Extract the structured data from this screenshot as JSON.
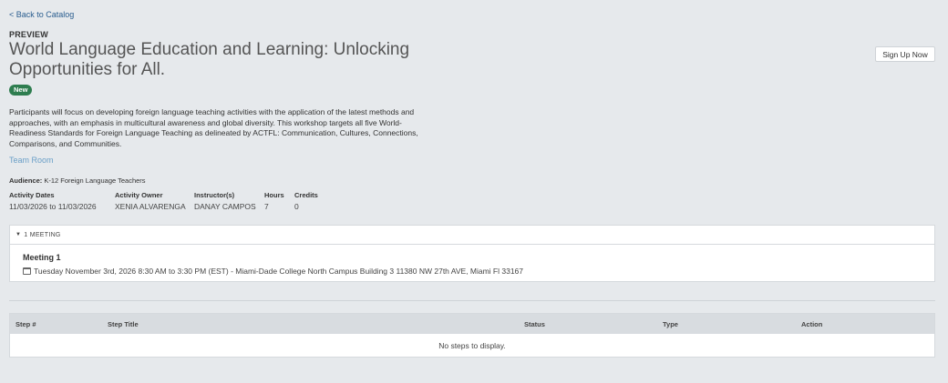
{
  "nav": {
    "back_label": "< Back to Catalog"
  },
  "course": {
    "preview_label": "PREVIEW",
    "title": "World Language Education and Learning: Unlocking Opportunities for All.",
    "badge": "New",
    "description": "Participants will focus on developing foreign language teaching activities with the application of the latest methods and approaches, with an emphasis in multicultural awareness and global diversity. This workshop targets all five World-Readiness Standards for Foreign Language Teaching as delineated by ACTFL: Communication, Cultures, Connections, Comparisons, and Communities.",
    "team_room_link": "Team Room",
    "audience_label": "Audience:",
    "audience_value": "K-12 Foreign Language Teachers",
    "signup_label": "Sign Up Now"
  },
  "meta": {
    "dates_label": "Activity Dates",
    "dates_value": "11/03/2026 to 11/03/2026",
    "owner_label": "Activity Owner",
    "owner_value": "XENIA ALVARENGA",
    "instructor_label": "Instructor(s)",
    "instructor_value": "DANAY CAMPOS",
    "hours_label": "Hours",
    "hours_value": "7",
    "credits_label": "Credits",
    "credits_value": "0"
  },
  "meetings": {
    "header": "1 MEETING",
    "items": [
      {
        "title": "Meeting 1",
        "detail": "Tuesday November 3rd, 2026 8:30 AM to 3:30 PM (EST) - Miami-Dade College North Campus Building 3 11380 NW 27th AVE, Miami Fl 33167"
      }
    ]
  },
  "steps": {
    "columns": [
      "Step #",
      "Step Title",
      "Status",
      "Type",
      "Action"
    ],
    "empty_text": "No steps to display."
  },
  "colors": {
    "background": "#e6e9ec",
    "link": "#2a5d8f",
    "badge": "#2e7d4f",
    "table_header": "#d8dce0"
  }
}
